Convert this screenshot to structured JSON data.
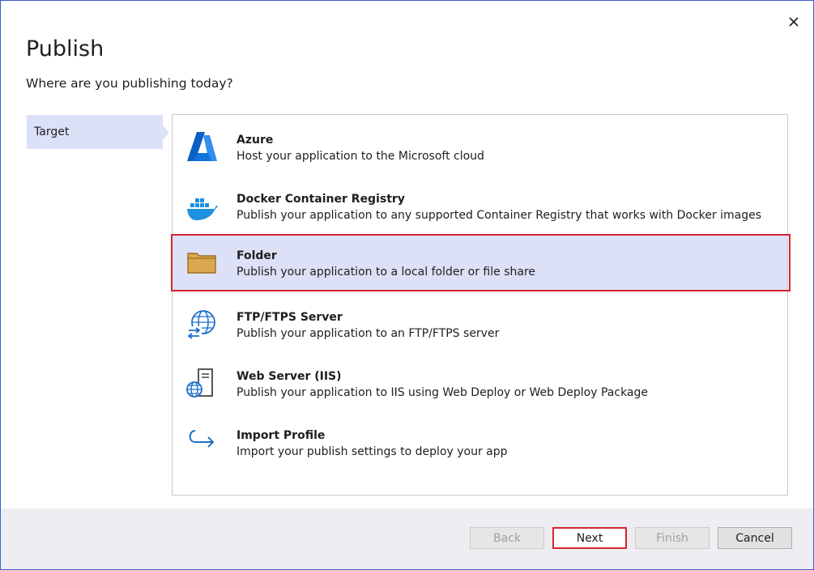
{
  "dialog": {
    "title": "Publish",
    "subtitle": "Where are you publishing today?",
    "close_icon": "close-icon"
  },
  "steps": [
    {
      "label": "Target",
      "active": true
    }
  ],
  "targets": [
    {
      "icon": "azure-icon",
      "name": "Azure",
      "description": "Host your application to the Microsoft cloud",
      "selected": false
    },
    {
      "icon": "docker-icon",
      "name": "Docker Container Registry",
      "description": "Publish your application to any supported Container Registry that works with Docker images",
      "selected": false
    },
    {
      "icon": "folder-icon",
      "name": "Folder",
      "description": "Publish your application to a local folder or file share",
      "selected": true
    },
    {
      "icon": "ftp-globe-icon",
      "name": "FTP/FTPS Server",
      "description": "Publish your application to an FTP/FTPS server",
      "selected": false
    },
    {
      "icon": "web-server-icon",
      "name": "Web Server (IIS)",
      "description": "Publish your application to IIS using Web Deploy or Web Deploy Package",
      "selected": false
    },
    {
      "icon": "import-arrow-icon",
      "name": "Import Profile",
      "description": "Import your publish settings to deploy your app",
      "selected": false
    }
  ],
  "buttons": {
    "back": {
      "label": "Back",
      "enabled": false
    },
    "next": {
      "label": "Next",
      "enabled": true
    },
    "finish": {
      "label": "Finish",
      "enabled": false
    },
    "cancel": {
      "label": "Cancel",
      "enabled": true
    }
  },
  "colors": {
    "accent_blue": "#3a5fcd",
    "selection_background": "#dde1f7",
    "highlight_red": "#d42431",
    "footer_background": "#eeeef2"
  }
}
